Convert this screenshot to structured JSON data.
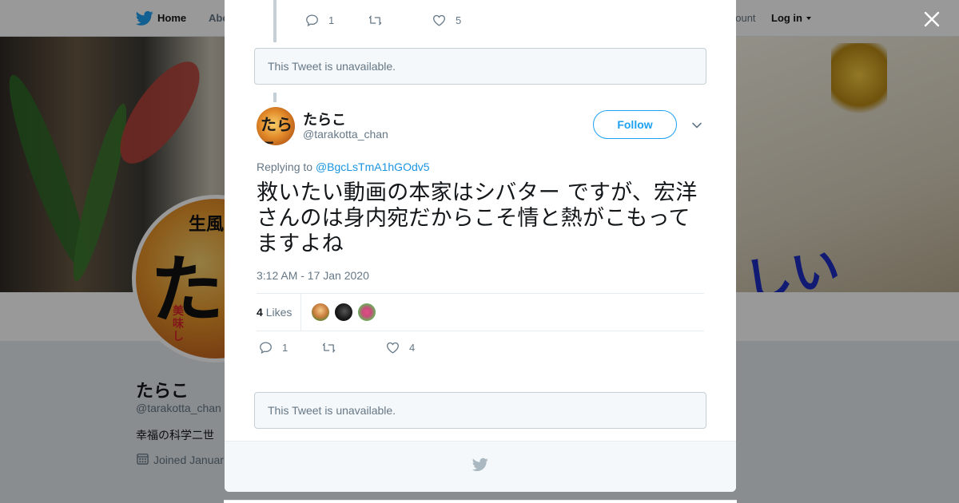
{
  "nav": {
    "home": "Home",
    "about": "Abo",
    "account_prompt": "ccount?",
    "login": "Log in"
  },
  "profile": {
    "name": "たらこ",
    "handle": "@tarakotta_chan",
    "bio": "幸福の科学二世",
    "joined": "Joined Januar",
    "avatar_text_top": "生風",
    "avatar_text_big": "た",
    "avatar_text_side": "美味し"
  },
  "modal": {
    "prev_actions": {
      "reply_count": "1",
      "like_count": "5"
    },
    "unavailable_1": "This Tweet is unavailable.",
    "tweet": {
      "avatar_text": "たらこ",
      "name": "たらこ",
      "handle": "@tarakotta_chan",
      "follow_label": "Follow",
      "replying_to_label": "Replying to",
      "replying_to_mention": "@BgcLsTmA1hGOdv5",
      "text": "救いたい動画の本家はシバター ですが、宏洋さんのは身内宛だからこそ情と熱がこもってますよね",
      "timestamp": "3:12 AM - 17 Jan 2020",
      "likes_count": "4",
      "likes_label": "Likes",
      "reply_count": "1",
      "like_count": "4"
    },
    "unavailable_2": "This Tweet is unavailable."
  },
  "colors": {
    "twitter_blue": "#1da1f2",
    "mention_blue": "#1b95e0",
    "secondary_text": "#657786",
    "border": "#e6ecf0"
  },
  "icons": {
    "logo": "twitter-bird-icon",
    "close": "close-icon",
    "reply": "reply-icon",
    "retweet": "retweet-icon",
    "like": "heart-icon",
    "more": "chevron-down-icon",
    "calendar": "calendar-icon"
  }
}
